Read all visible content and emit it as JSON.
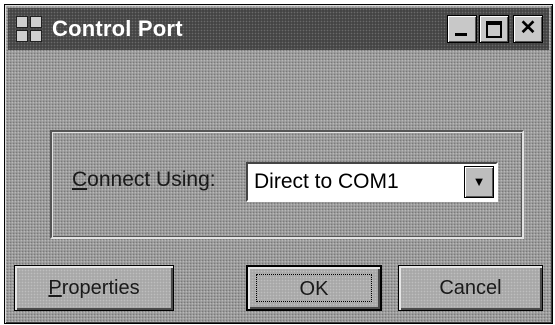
{
  "window": {
    "title": "Control Port",
    "close_glyph": "✕"
  },
  "connection": {
    "label_accel": "C",
    "label_rest": "onnect Using:",
    "selected_value": "Direct to COM1",
    "dropdown_arrow": "▼"
  },
  "buttons": {
    "properties_accel": "P",
    "properties_rest": "roperties",
    "ok_label": "OK",
    "cancel_label": "Cancel"
  },
  "icons": {
    "title_icon": "phone-window-icon",
    "minimize": "minimize-icon",
    "maximize": "maximize-icon",
    "close": "close-icon",
    "dropdown": "chevron-down-icon"
  }
}
